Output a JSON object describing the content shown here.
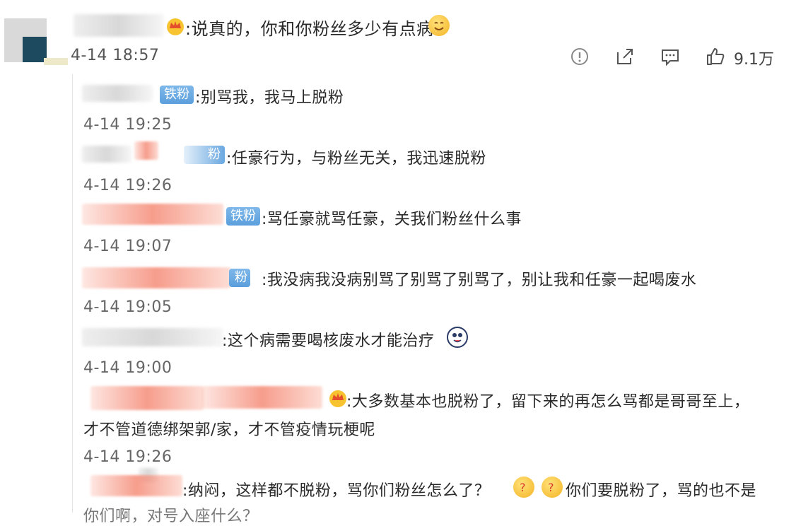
{
  "main_comment": {
    "text": ":说真的，你和你粉丝多少有点病",
    "time": "4-14 18:57",
    "like_count": "9.1万",
    "icons": [
      "warning-icon",
      "share-icon",
      "comment-icon",
      "like-icon"
    ]
  },
  "badge_label": "铁粉",
  "replies": [
    {
      "text": ":别骂我，我马上脱粉",
      "time": "4-14 19:25"
    },
    {
      "text": ":任豪行为，与粉丝无关，我迅速脱粉",
      "time": "4-14 19:26"
    },
    {
      "text": ":骂任豪就骂任豪，关我们粉丝什么事",
      "time": "4-14 19:07"
    },
    {
      "text": ":我没病我没病别骂了别骂了别骂了，别让我和任豪一起喝废水",
      "time": "4-14 19:05"
    },
    {
      "text": ":这个病需要喝核废水才能治疗",
      "time": "4-14 19:00"
    },
    {
      "text_line1": ":大多数基本也脱粉了，留下来的再怎么骂都是哥哥至上，",
      "text_line2": "才不管道德绑架郭/家，才不管疫情玩梗呢",
      "time": "4-14 19:26"
    },
    {
      "text_line1": ":纳闷，这样都不脱粉，骂你们粉丝怎么了？",
      "text_line1b": "你们要脱粉了，骂的也不是",
      "text_line2": "你们啊，对号入座什么？"
    }
  ]
}
